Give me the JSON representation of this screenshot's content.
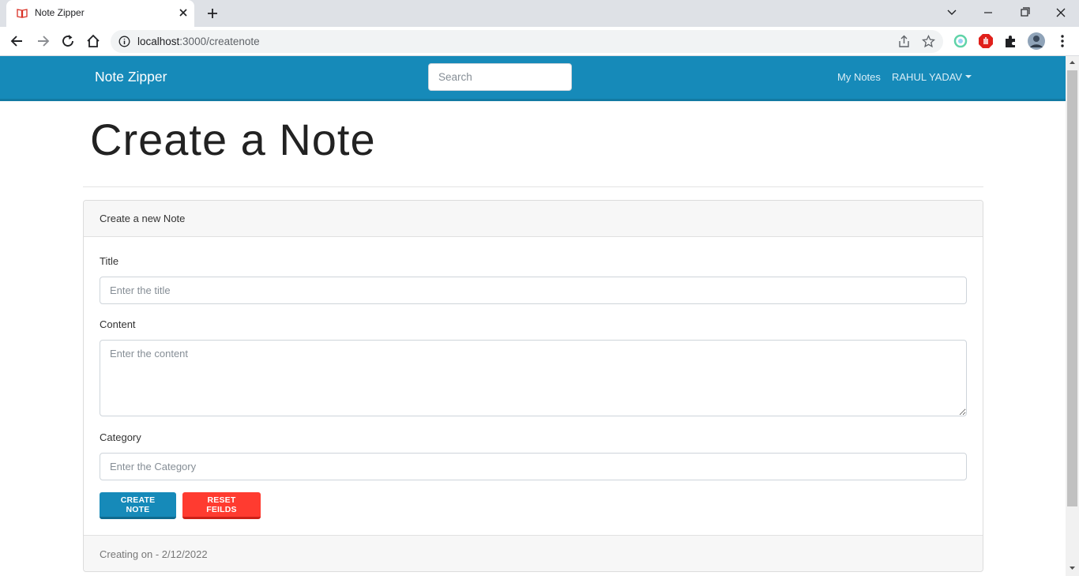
{
  "browser": {
    "tab_title": "Note Zipper",
    "url_host": "localhost",
    "url_rest": ":3000/createnote"
  },
  "navbar": {
    "brand": "Note Zipper",
    "search_placeholder": "Search",
    "my_notes": "My Notes",
    "user_menu": "RAHUL YADAV"
  },
  "page": {
    "title": "Create a Note"
  },
  "card": {
    "header": "Create a new Note",
    "title_label": "Title",
    "title_placeholder": "Enter the title",
    "content_label": "Content",
    "content_placeholder": "Enter the content",
    "category_label": "Category",
    "category_placeholder": "Enter the Category",
    "create_button": "CREATE NOTE",
    "reset_button": "RESET FEILDS",
    "footer": "Creating on - 2/12/2022"
  },
  "colors": {
    "primary": "#168ab9",
    "danger": "#ff3b30"
  }
}
